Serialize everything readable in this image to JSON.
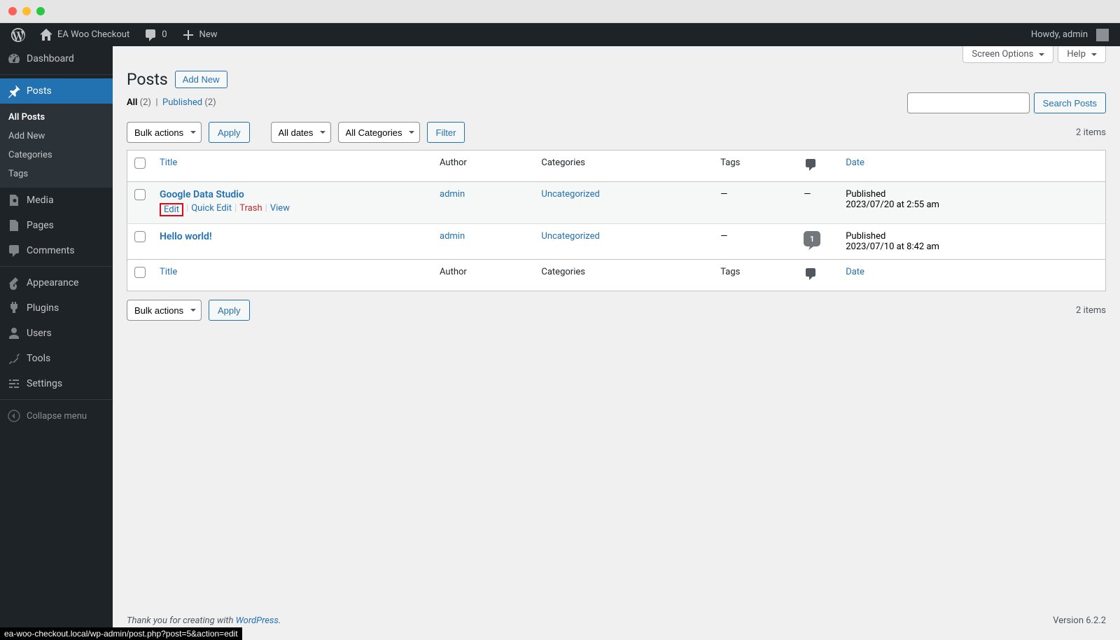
{
  "adminbar": {
    "site_name": "EA Woo Checkout",
    "comments_count": "0",
    "new_label": "New",
    "howdy": "Howdy, admin"
  },
  "sidebar": {
    "dashboard": "Dashboard",
    "posts": "Posts",
    "submenu": {
      "all": "All Posts",
      "add_new": "Add New",
      "categories": "Categories",
      "tags": "Tags"
    },
    "media": "Media",
    "pages": "Pages",
    "comments": "Comments",
    "appearance": "Appearance",
    "plugins": "Plugins",
    "users": "Users",
    "tools": "Tools",
    "settings": "Settings",
    "collapse": "Collapse menu"
  },
  "header": {
    "title": "Posts",
    "add_new": "Add New",
    "screen_options": "Screen Options",
    "help": "Help"
  },
  "filters": {
    "all_label": "All",
    "all_count": "(2)",
    "published_label": "Published",
    "published_count": "(2)",
    "search_btn": "Search Posts",
    "bulk_actions": "Bulk actions",
    "apply": "Apply",
    "all_dates": "All dates",
    "all_categories": "All Categories",
    "filter": "Filter",
    "items_count": "2 items"
  },
  "table": {
    "cols": {
      "title": "Title",
      "author": "Author",
      "categories": "Categories",
      "tags": "Tags",
      "date": "Date"
    },
    "rows": [
      {
        "title": "Google Data Studio",
        "author": "admin",
        "categories": "Uncategorized",
        "tags": "—",
        "comments": "—",
        "date_status": "Published",
        "date_time": "2023/07/20 at 2:55 am",
        "show_actions": true
      },
      {
        "title": "Hello world!",
        "author": "admin",
        "categories": "Uncategorized",
        "tags": "—",
        "comments": "1",
        "date_status": "Published",
        "date_time": "2023/07/10 at 8:42 am",
        "show_actions": false
      }
    ],
    "row_actions": {
      "edit": "Edit",
      "quick_edit": "Quick Edit",
      "trash": "Trash",
      "view": "View"
    }
  },
  "footer": {
    "thank_you_pre": "Thank you for creating with ",
    "wp": "WordPress",
    "version": "Version 6.2.2"
  },
  "status_url": "ea-woo-checkout.local/wp-admin/post.php?post=5&action=edit"
}
